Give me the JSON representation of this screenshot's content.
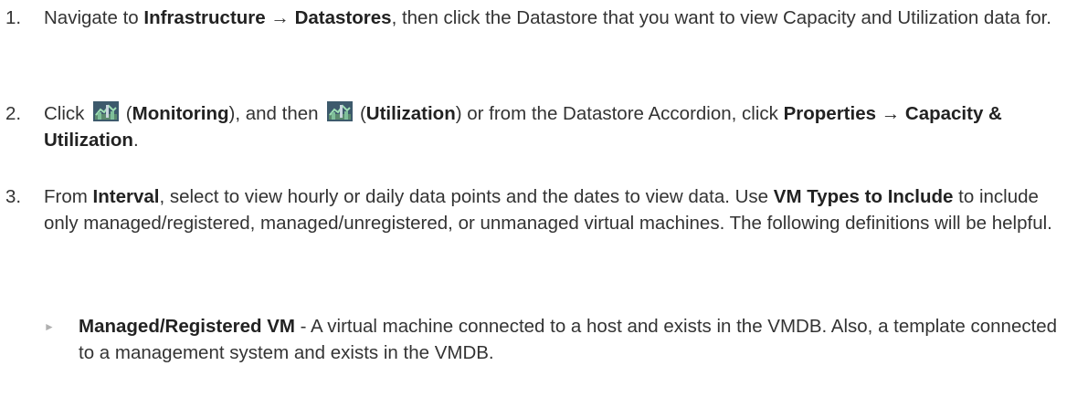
{
  "steps": [
    {
      "number": "1.",
      "parts": [
        "Navigate to ",
        "Infrastructure",
        " → ",
        "Datastores",
        ", then click the Datastore that you want to view Capacity and Utilization data for."
      ]
    },
    {
      "number": "2.",
      "parts": [
        "Click ",
        " (",
        "Monitoring",
        "), and then ",
        " (",
        "Utilization",
        ") or from the Datastore Accordion, click ",
        "Properties → Capacity & Utilization",
        "."
      ],
      "icons": [
        "monitoring-icon",
        "utilization-icon"
      ]
    },
    {
      "number": "3.",
      "parts": [
        "From ",
        "Interval",
        ", select to view hourly or daily data points and the dates to view data. Use ",
        "VM Types to Include",
        " to include only managed/registered, managed/unregistered, or unmanaged virtual machines. The following definitions will be helpful."
      ]
    }
  ],
  "definitions": [
    {
      "term": "Managed/Registered VM",
      "text": " - A virtual machine connected to a host and exists in the VMDB. Also, a template connected to a management system and exists in the VMDB."
    }
  ],
  "colors": {
    "text": "#333333",
    "icon_bg": "#3d5a6c",
    "icon_chart": "#7fbf9a",
    "bullet": "#b0b0b0"
  }
}
